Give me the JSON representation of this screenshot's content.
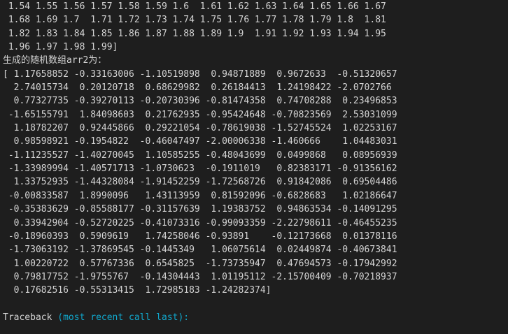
{
  "terminal": {
    "lines": [
      " 1.54 1.55 1.56 1.57 1.58 1.59 1.6  1.61 1.62 1.63 1.64 1.65 1.66 1.67",
      " 1.68 1.69 1.7  1.71 1.72 1.73 1.74 1.75 1.76 1.77 1.78 1.79 1.8  1.81",
      " 1.82 1.83 1.84 1.85 1.86 1.87 1.88 1.89 1.9  1.91 1.92 1.93 1.94 1.95",
      " 1.96 1.97 1.98 1.99]",
      "生成的随机数组arr2为：",
      "[ 1.17658852 -0.33163006 -1.10519898  0.94871889  0.9672633  -0.51320657",
      "  2.74015734  0.20120718  0.68629982  0.26184413  1.24198422 -2.0702766",
      "  0.77327735 -0.39270113 -0.20730396 -0.81474358  0.74708288  0.23496853",
      " -1.65155791  1.84098603  0.21762935 -0.95424648 -0.70823569  2.53031099",
      "  1.18782207  0.92445866  0.29221054 -0.78619038 -1.52745524  1.02253167",
      "  0.98598921 -0.1954822  -0.46047497 -2.00006338 -1.460666    1.04483031",
      " -1.11235527 -1.40270045  1.10585255 -0.48043699  0.0499868   0.08956939",
      " -1.33989994 -1.40571713 -1.0730623  -0.1911019   0.82383171 -0.91356162",
      "  1.33752935 -1.44328084 -1.91452259 -1.72568726  0.91842086  0.69504486",
      " -0.00833587  1.8990096   1.43113959  0.81592096 -0.6828683   1.02186647",
      " -0.35383629 -0.85588177 -0.31157639  1.19383752  0.94863534 -0.14091295",
      "  0.33942904 -0.52720225 -0.41073316 -0.99093359 -2.22798611 -0.46455235",
      " -0.18960393  0.5909619   1.74258046 -0.93891    -0.12173668  0.01378116",
      " -1.73063192 -1.37869545 -0.1445349   1.06075614  0.02449874 -0.40673841",
      "  1.00220722  0.57767336  0.6545825  -1.73735947  0.47694573 -0.17942992",
      "  0.79817752 -1.9755767  -0.14304443  1.01195112 -2.15700409 -0.70218937",
      "  0.17682516 -0.55313415  1.72985183 -1.24282374]"
    ],
    "traceback": {
      "prefix": "Traceback ",
      "highlight": "(most recent call last):"
    }
  },
  "colors": {
    "background": "#1e1e1e",
    "text": "#d4d4d4",
    "traceback_highlight": "#11a8cd"
  }
}
